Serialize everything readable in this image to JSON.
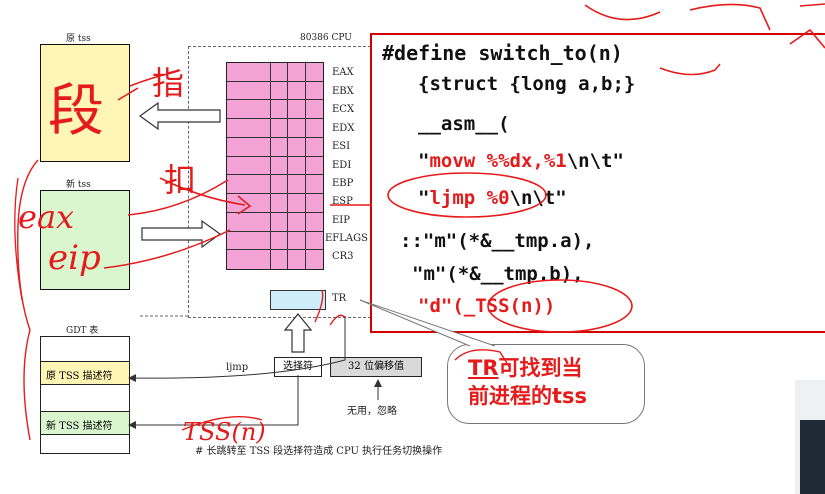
{
  "diagram": {
    "orig_tss_label": "原 tss",
    "new_tss_label": "新 tss",
    "cpu_label": "80386 CPU",
    "registers": [
      "EAX",
      "EBX",
      "ECX",
      "EDX",
      "ESI",
      "EDI",
      "EBP",
      "ESP",
      "EIP",
      "EFLAGS",
      "CR3"
    ],
    "tr_label": "TR",
    "gdt_label": "GDT 表",
    "gdt_orig_desc": "原 TSS 描述符",
    "gdt_new_desc": "新 TSS 描述符",
    "ljmp_label": "ljmp",
    "selector_label": "选择符",
    "offset_label": "32 位偏移值",
    "unused_label": "无用，忽略",
    "caption": "# 长跳转至 TSS 段选择符造成 CPU 执行任务切换操作"
  },
  "code": {
    "line1": "#define switch_to(n)",
    "line2": "{struct {long a,b;}",
    "line3": "__asm__(",
    "line4a": "\"",
    "line4b": "movw %%dx,%1",
    "line4c": "\\n\\t\"",
    "line5a": "\"",
    "line5b": "ljmp %0",
    "line5c": "\\n\\t\"",
    "line6": "::\"m\"(*&__tmp.a),",
    "line7": "\"m\"(*&__tmp.b),",
    "line8": "\"d\"(_TSS(n))"
  },
  "callout": {
    "highlight": "TR",
    "line1_rest": "可找到当",
    "line2": "前进程的tss"
  },
  "handwriting": {
    "duan": "段",
    "zhi": "指",
    "kou": "扣",
    "eax": "eax",
    "eip": "eip",
    "tss_n": "TSS(n)"
  },
  "colors": {
    "orig_tss": "#fff5b4",
    "new_tss": "#d9f6cf",
    "registers": "#f3a3d5",
    "tr": "#cdeef9",
    "accent_red": "#e51a1a"
  }
}
